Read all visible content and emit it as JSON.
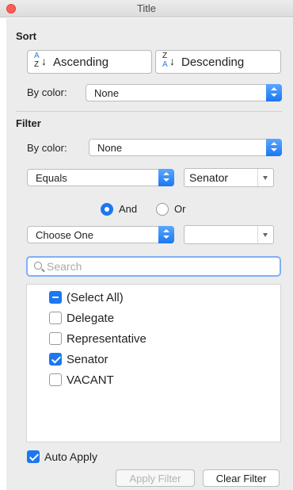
{
  "window": {
    "title": "Title"
  },
  "sort": {
    "section_title": "Sort",
    "ascending": {
      "label": "Ascending",
      "glyph_top": "A",
      "glyph_bottom": "Z",
      "glyph_arrow": "↓"
    },
    "descending": {
      "label": "Descending",
      "glyph_top": "Z",
      "glyph_bottom": "A",
      "glyph_arrow": "↓"
    },
    "by_color_label": "By color:",
    "by_color_value": "None"
  },
  "filter": {
    "section_title": "Filter",
    "by_color_label": "By color:",
    "by_color_value": "None",
    "condition1": {
      "operator": "Equals",
      "value": "Senator"
    },
    "logic": {
      "and_label": "And",
      "or_label": "Or",
      "selected": "And"
    },
    "condition2": {
      "operator": "Choose One",
      "value": ""
    },
    "search": {
      "placeholder": "Search",
      "value": ""
    },
    "items": [
      {
        "label": "(Select All)",
        "state": "mixed"
      },
      {
        "label": "Delegate",
        "state": "unchecked"
      },
      {
        "label": "Representative",
        "state": "unchecked"
      },
      {
        "label": "Senator",
        "state": "checked"
      },
      {
        "label": "VACANT",
        "state": "unchecked"
      }
    ],
    "auto_apply": {
      "label": "Auto Apply",
      "checked": true
    },
    "apply_button": "Apply Filter",
    "clear_button": "Clear Filter"
  },
  "colors": {
    "accent": "#1c77f2",
    "close_button": "#fd5f57"
  }
}
